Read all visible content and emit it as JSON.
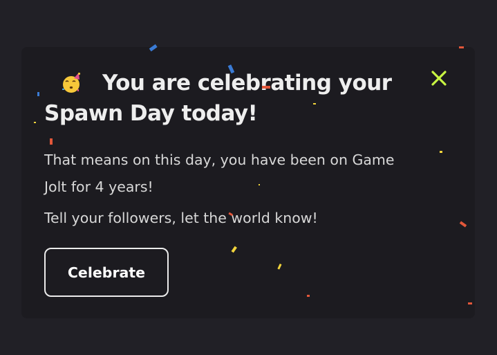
{
  "notification": {
    "title": "You are celebrating your Spawn Day today!",
    "message_lines": [
      "That means on this day, you have been on Game Jolt for 4 years!",
      "Tell your followers, let the world know!"
    ],
    "button_label": "Celebrate",
    "emoji_icon": "party-face-icon",
    "close_icon": "close-icon"
  },
  "colors": {
    "background": "#212026",
    "card": "#1c1b20",
    "text": "#d8d8d8",
    "title": "#eeeeee",
    "close_icon": "#c8f542",
    "button_border": "#ececec"
  }
}
